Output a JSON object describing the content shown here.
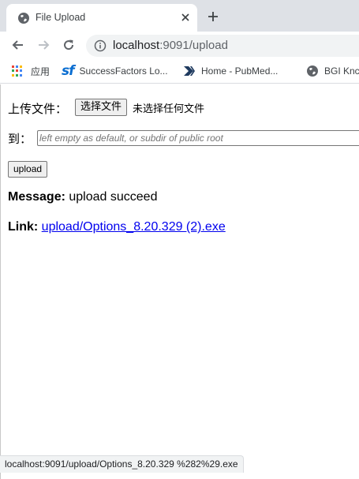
{
  "tab": {
    "title": "File Upload"
  },
  "address_bar": {
    "host": "localhost",
    "rest": ":9091/upload"
  },
  "bookmarks": [
    {
      "label": "应用",
      "icon": "apps-grid-icon"
    },
    {
      "label": "SuccessFactors Lo...",
      "icon": "successfactors-logo-icon"
    },
    {
      "label": "Home - PubMed...",
      "icon": "pubmed-logo-icon"
    },
    {
      "label": "BGI Knc",
      "icon": "globe-icon"
    }
  ],
  "form": {
    "file_label": "上传文件：",
    "file_button": "选择文件",
    "file_status": "未选择任何文件",
    "dest_label": "到：",
    "dest_placeholder": "left empty as default, or subdir of public root",
    "upload_button": "upload"
  },
  "result": {
    "message_label": "Message:",
    "message_value": "upload succeed",
    "link_label": "Link:",
    "link_text": "upload/Options_8.20.329 (2).exe"
  },
  "status_bar": {
    "text": "localhost:9091/upload/Options_8.20.329 %282%29.exe"
  },
  "colors": {
    "link": "#0000ee",
    "sf_brand": "#0a6ed1",
    "tabstrip": "#dee1e6"
  }
}
